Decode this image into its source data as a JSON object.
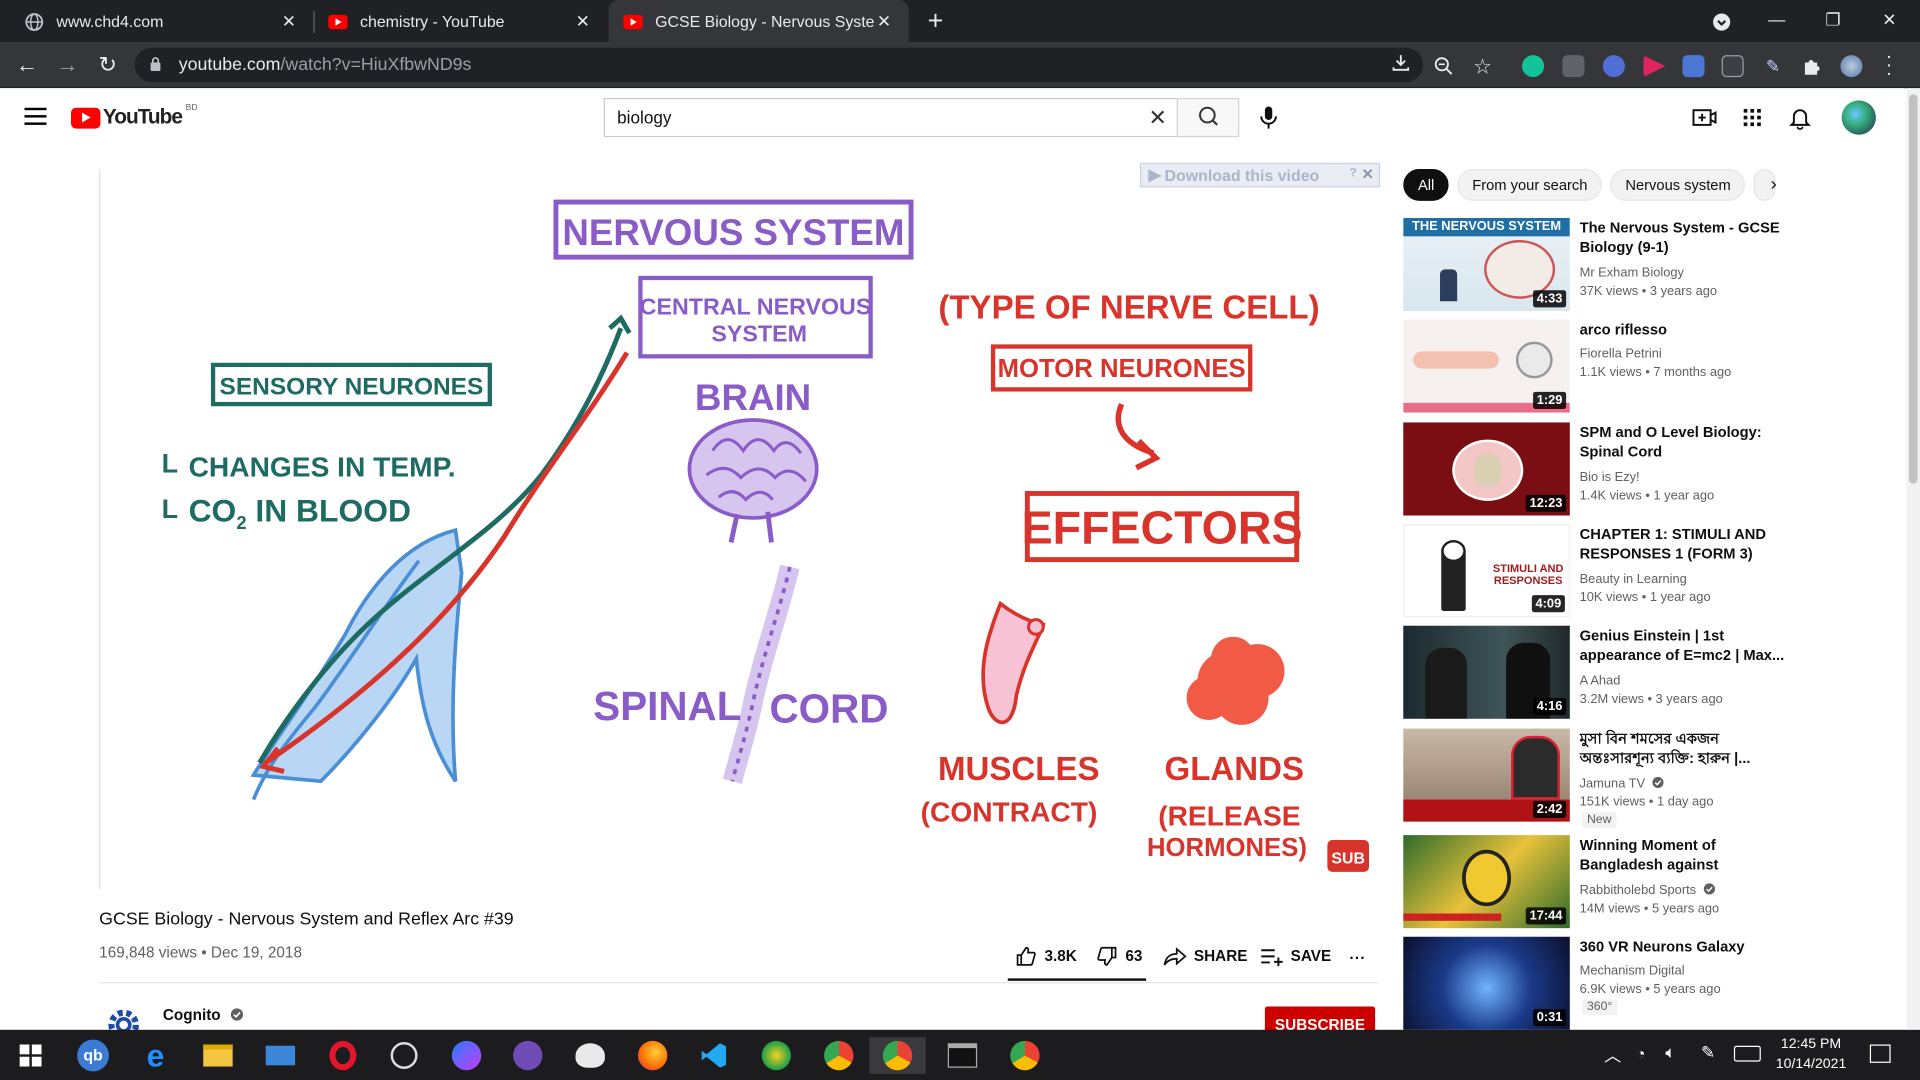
{
  "browser": {
    "tabs": [
      {
        "title": "www.chd4.com",
        "active": false
      },
      {
        "title": "chemistry - YouTube",
        "active": false
      },
      {
        "title": "GCSE Biology - Nervous System a",
        "active": true
      }
    ],
    "url_host": "youtube.com",
    "url_path": "/watch?v=HiuXfbwND9s"
  },
  "youtube": {
    "logo_text": "YouTube",
    "country": "BD",
    "search_query": "biology"
  },
  "player": {
    "download_bar": "Download this video",
    "download_help": "?",
    "board": {
      "nervous_system": "NERVOUS SYSTEM",
      "cns": [
        "CENTRAL NERVOUS",
        "SYSTEM"
      ],
      "brain": "BRAIN",
      "spinal": "SPINAL",
      "cord": "CORD",
      "sensory": "SENSORY NEURONES",
      "change1": "CHANGES IN TEMP.",
      "change2": "CO",
      "change2_sub": "2",
      "change2_rest": " IN BLOOD",
      "type": "(TYPE OF NERVE CELL)",
      "motor": "MOTOR NEURONES",
      "effectors": "EFFECTORS",
      "muscles": "MUSCLES",
      "contract": "(CONTRACT)",
      "glands": "GLANDS",
      "release1": "(RELEASE",
      "release2": "HORMONES)",
      "sub_badge": "SUB"
    }
  },
  "video": {
    "title": "GCSE Biology - Nervous System and Reflex Arc #39",
    "meta": "169,848 views • Dec 19, 2018",
    "likes": "3.8K",
    "dislikes": "63",
    "share": "SHARE",
    "save": "SAVE",
    "more": "...",
    "channel": "Cognito",
    "subscribe": "SUBSCRIBE"
  },
  "chips": [
    "All",
    "From your search",
    "Nervous system"
  ],
  "recommendations": [
    {
      "title": "The Nervous System - GCSE Biology (9-1)",
      "channel": "Mr Exham Biology",
      "views": "37K views • 3 years ago",
      "duration": "4:33",
      "thumb_text": "THE NERVOUS SYSTEM",
      "verified": false
    },
    {
      "title": "arco riflesso",
      "channel": "Fiorella Petrini",
      "views": "1.1K views • 7 months ago",
      "duration": "1:29",
      "verified": false
    },
    {
      "title": "SPM and O Level Biology: Spinal Cord",
      "channel": "Bio is Ezy!",
      "views": "1.4K views • 1 year ago",
      "duration": "12:23",
      "verified": false
    },
    {
      "title": "CHAPTER 1: STIMULI AND RESPONSES 1 (FORM 3)",
      "channel": "Beauty in Learning",
      "views": "10K views • 1 year ago",
      "duration": "4:09",
      "thumb_text": "STIMULI AND RESPONSES",
      "verified": false
    },
    {
      "title": "Genius Einstein | 1st appearance of E=mc2 | Max...",
      "channel": "A Ahad",
      "views": "3.2M views • 3 years ago",
      "duration": "4:16",
      "verified": false
    },
    {
      "title": "মুসা বিন শমসের একজন অন্তঃসারশূন্য ব্যক্তি: হারুন |...",
      "channel": "Jamuna TV",
      "views": "151K views • 1 day ago",
      "duration": "2:42",
      "badge": "New",
      "verified": true
    },
    {
      "title": "Winning Moment of Bangladesh against Pakistan...",
      "channel": "Rabbitholebd Sports",
      "views": "14M views • 5 years ago",
      "duration": "17:44",
      "verified": true
    },
    {
      "title": "360 VR Neurons Galaxy",
      "channel": "Mechanism Digital",
      "views": "6.9K views • 5 years ago",
      "duration": "0:31",
      "badge": "360°",
      "verified": false
    }
  ],
  "taskbar": {
    "time": "12:45 PM",
    "date": "10/14/2021"
  },
  "colors": {
    "board_purple": "#8a5cc7",
    "board_red": "#d9342b",
    "board_teal": "#1e6b64",
    "yt_red": "#ff0000",
    "subscribe_red": "#cc0000"
  }
}
